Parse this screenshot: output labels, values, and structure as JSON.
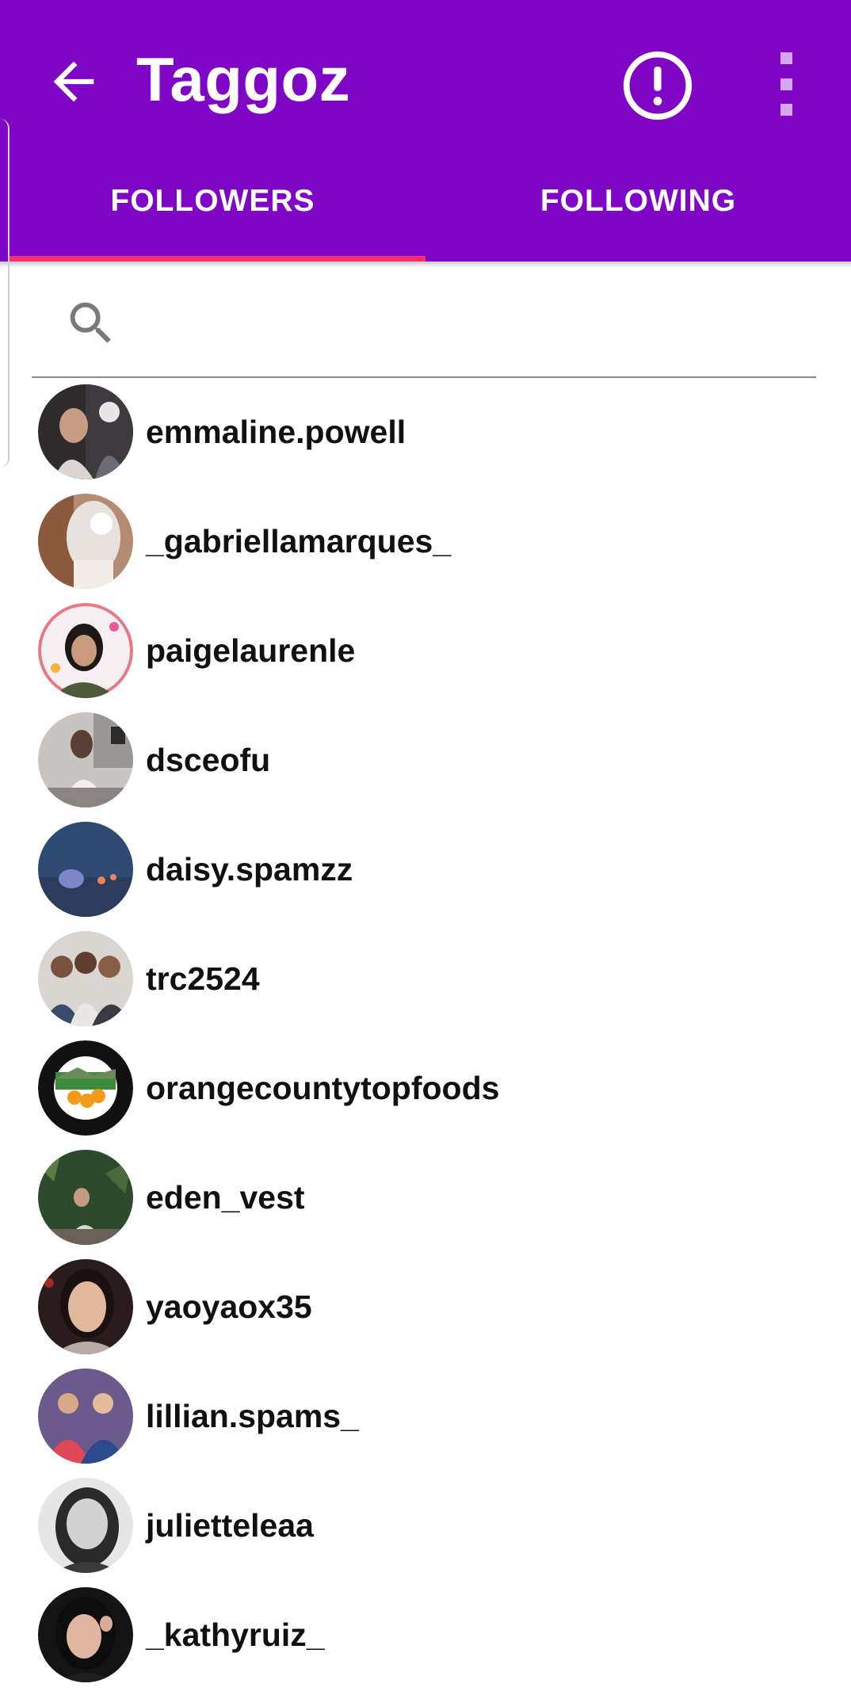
{
  "header": {
    "title": "Taggoz",
    "back_icon": "arrow-left-icon",
    "report_icon": "exclamation-circle-icon",
    "menu_icon": "more-vertical-icon",
    "background_color": "#7e06c4",
    "indicator_color": "#ff2d6e"
  },
  "tabs": [
    {
      "label": "FOLLOWERS",
      "active": true
    },
    {
      "label": "FOLLOWING",
      "active": false
    }
  ],
  "search": {
    "placeholder": "",
    "value": "",
    "icon": "search-icon"
  },
  "followers": [
    {
      "username": "emmaline.powell"
    },
    {
      "username": "_gabriellamarques_"
    },
    {
      "username": "paigelaurenle"
    },
    {
      "username": "dsceofu"
    },
    {
      "username": "daisy.spamzz"
    },
    {
      "username": "trc2524"
    },
    {
      "username": "orangecountytopfoods"
    },
    {
      "username": "eden_vest"
    },
    {
      "username": "yaoyaox35"
    },
    {
      "username": "lillian.spams_"
    },
    {
      "username": "julietteleaa"
    },
    {
      "username": "_kathyruiz_"
    }
  ]
}
